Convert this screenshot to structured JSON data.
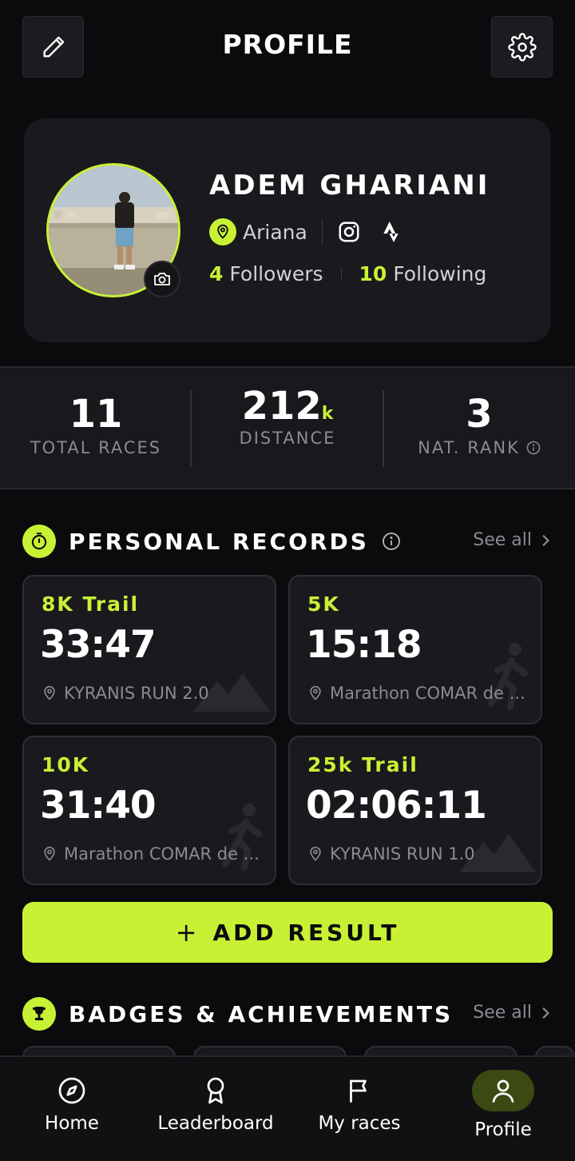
{
  "header": {
    "title": "PROFILE",
    "edit_icon": "pencil-icon",
    "settings_icon": "gear-icon"
  },
  "profile": {
    "name": "ADEM GHARIANI",
    "location": "Ariana",
    "followers_count": "4",
    "followers_label": "Followers",
    "following_count": "10",
    "following_label": "Following"
  },
  "stats": {
    "total_races": {
      "value": "11",
      "label": "TOTAL RACES"
    },
    "distance": {
      "value": "212",
      "unit": "k",
      "label": "DISTANCE"
    },
    "nat_rank": {
      "value": "3",
      "label": "NAT. RANK"
    }
  },
  "personal_records": {
    "title": "PERSONAL RECORDS",
    "see_all": "See all",
    "items": [
      {
        "distance": "8K Trail",
        "time": "33:47",
        "event": "KYRANIS RUN 2.0",
        "deco": "mountain-icon"
      },
      {
        "distance": "5K",
        "time": "15:18",
        "event": "Marathon COMAR de ...",
        "deco": "runner-icon"
      },
      {
        "distance": "10K",
        "time": "31:40",
        "event": "Marathon COMAR de ...",
        "deco": "runner-icon"
      },
      {
        "distance": "25k Trail",
        "time": "02:06:11",
        "event": "KYRANIS RUN 1.0",
        "deco": "mountain-icon"
      }
    ]
  },
  "add_result": {
    "label": "ADD RESULT"
  },
  "badges": {
    "title": "BADGES & ACHIEVEMENTS",
    "see_all": "See all"
  },
  "nav": {
    "items": [
      {
        "label": "Home",
        "icon": "compass-icon"
      },
      {
        "label": "Leaderboard",
        "icon": "medal-icon"
      },
      {
        "label": "My races",
        "icon": "flag-icon"
      },
      {
        "label": "Profile",
        "icon": "user-icon",
        "active": true
      }
    ]
  },
  "colors": {
    "accent": "#c8f135",
    "background": "#0b0b0d",
    "card": "#1a191d"
  }
}
